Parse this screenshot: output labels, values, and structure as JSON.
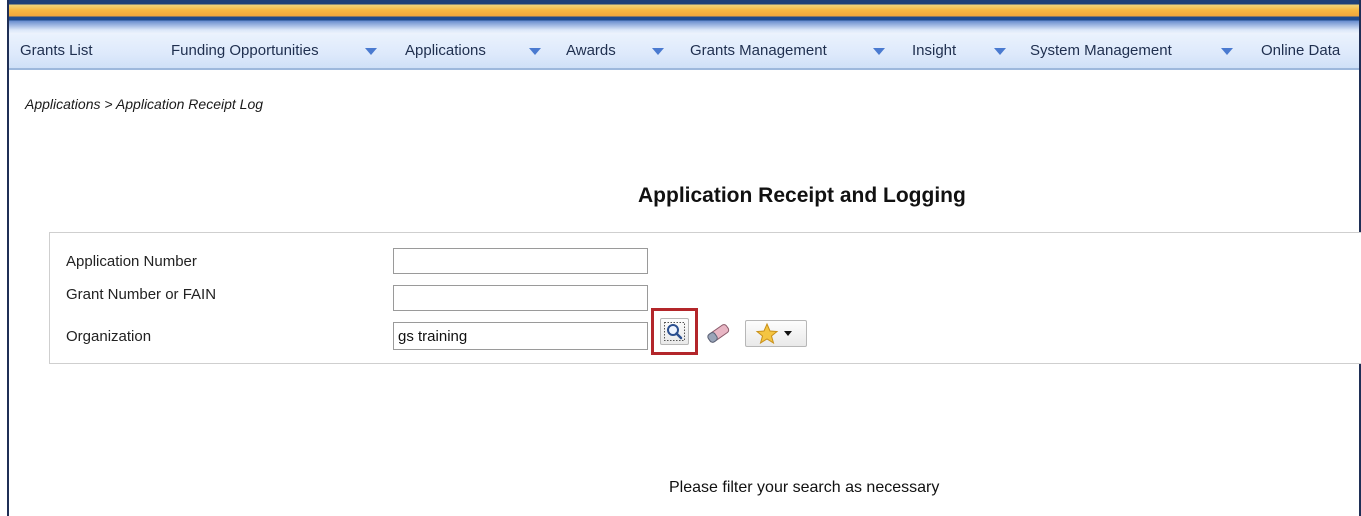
{
  "nav": {
    "items": [
      {
        "label": "Grants List",
        "has_dropdown": false
      },
      {
        "label": "Funding Opportunities",
        "has_dropdown": true
      },
      {
        "label": "Applications",
        "has_dropdown": true
      },
      {
        "label": "Awards",
        "has_dropdown": true
      },
      {
        "label": "Grants Management",
        "has_dropdown": true
      },
      {
        "label": "Insight",
        "has_dropdown": true
      },
      {
        "label": "System Management",
        "has_dropdown": true
      },
      {
        "label": "Online Data",
        "has_dropdown": false
      }
    ]
  },
  "breadcrumb": "Applications > Application Receipt Log",
  "page_title": "Application Receipt and Logging",
  "filters": {
    "application_number": {
      "label": "Application Number",
      "value": ""
    },
    "grant_number": {
      "label": "Grant Number or FAIN",
      "value": ""
    },
    "organization": {
      "label": "Organization",
      "value": "gs training"
    }
  },
  "icons": {
    "search": "magnifier-icon",
    "clear": "eraser-icon",
    "favorites": "star-icon"
  },
  "colors": {
    "highlight": "#b3262a",
    "nav_text": "#1f2f4f",
    "nav_arrow": "#4a7ad0"
  },
  "message": "Please filter your search as necessary"
}
